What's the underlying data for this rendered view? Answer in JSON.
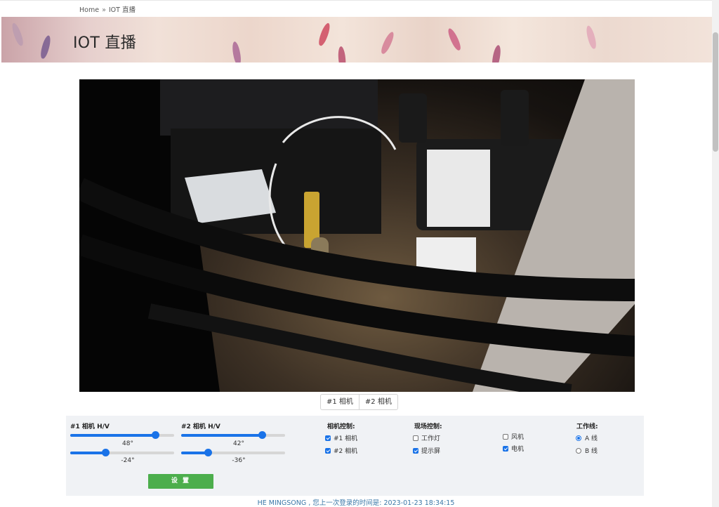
{
  "breadcrumb": {
    "home": "Home",
    "separator": "»",
    "current": "IOT 直播"
  },
  "banner": {
    "title": "IOT 直播"
  },
  "camera_tabs": [
    "#1 相机",
    "#2 相机"
  ],
  "sliders": {
    "cam1_title": "#1 相机 H/V",
    "cam2_title": "#2 相机 H/V",
    "cam1_h": {
      "display": "48°",
      "level": 0.82
    },
    "cam1_v": {
      "display": "-24°",
      "level": 0.34
    },
    "cam2_h": {
      "display": "42°",
      "level": 0.78
    },
    "cam2_v": {
      "display": "-36°",
      "level": 0.26
    }
  },
  "camera_control": {
    "title": "相机控制:",
    "items": [
      {
        "label": "#1 相机",
        "checked": true
      },
      {
        "label": "#2 相机",
        "checked": true
      }
    ]
  },
  "site_control": {
    "title": "现场控制:",
    "items": [
      {
        "label": "工作灯",
        "checked": false
      },
      {
        "label": "提示屏",
        "checked": true
      },
      {
        "label": "风机",
        "checked": false
      },
      {
        "label": "电机",
        "checked": true
      }
    ]
  },
  "work_line": {
    "title": "工作线:",
    "options": [
      {
        "label": "A 线",
        "selected": true
      },
      {
        "label": "B 线",
        "selected": false
      }
    ]
  },
  "set_button": "设 置",
  "footer": "HE MINGSONG , 您上一次登录的时间是: 2023-01-23 18:34:15",
  "colors": {
    "accent": "#1a73e8",
    "button": "#4cae4c",
    "footer_text": "#3b78a8",
    "panel_bg": "#f0f2f5"
  }
}
